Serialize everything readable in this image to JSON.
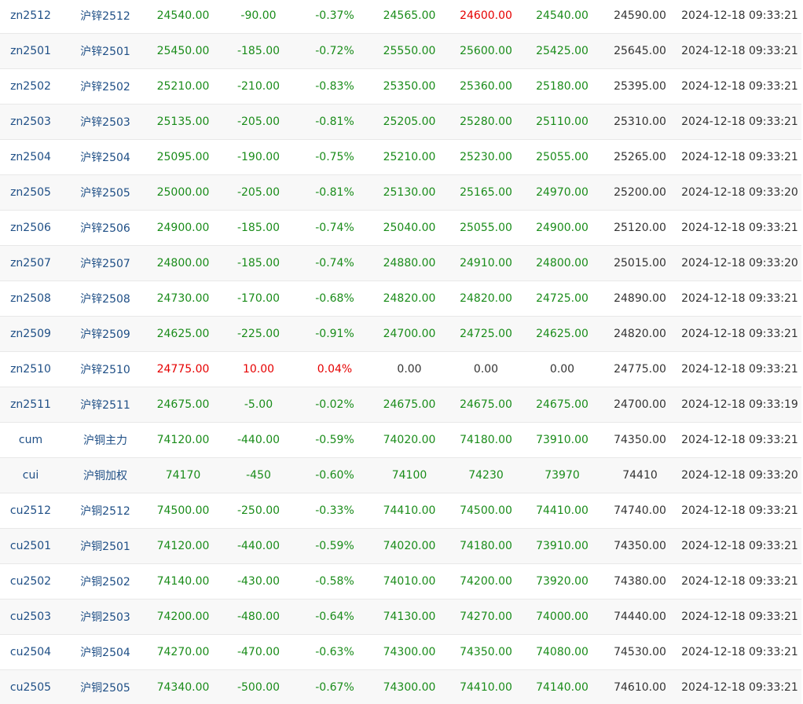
{
  "colors": {
    "up": "#e60000",
    "down": "#1a8c1a",
    "flat": "#333333",
    "link": "#1f4f86"
  },
  "rows": [
    {
      "code": "zn2512",
      "name": "沪锌2512",
      "last": "24540.00",
      "change": "-90.00",
      "pct": "-0.37%",
      "open": "24565.00",
      "high": "24600.00",
      "low": "24540.00",
      "prev": "24590.00",
      "time": "2024-12-18 09:33:21",
      "trend": "down",
      "open_c": "down",
      "high_c": "up",
      "low_c": "down"
    },
    {
      "code": "zn2501",
      "name": "沪锌2501",
      "last": "25450.00",
      "change": "-185.00",
      "pct": "-0.72%",
      "open": "25550.00",
      "high": "25600.00",
      "low": "25425.00",
      "prev": "25645.00",
      "time": "2024-12-18 09:33:21",
      "trend": "down",
      "open_c": "down",
      "high_c": "down",
      "low_c": "down"
    },
    {
      "code": "zn2502",
      "name": "沪锌2502",
      "last": "25210.00",
      "change": "-210.00",
      "pct": "-0.83%",
      "open": "25350.00",
      "high": "25360.00",
      "low": "25180.00",
      "prev": "25395.00",
      "time": "2024-12-18 09:33:21",
      "trend": "down",
      "open_c": "down",
      "high_c": "down",
      "low_c": "down"
    },
    {
      "code": "zn2503",
      "name": "沪锌2503",
      "last": "25135.00",
      "change": "-205.00",
      "pct": "-0.81%",
      "open": "25205.00",
      "high": "25280.00",
      "low": "25110.00",
      "prev": "25310.00",
      "time": "2024-12-18 09:33:21",
      "trend": "down",
      "open_c": "down",
      "high_c": "down",
      "low_c": "down"
    },
    {
      "code": "zn2504",
      "name": "沪锌2504",
      "last": "25095.00",
      "change": "-190.00",
      "pct": "-0.75%",
      "open": "25210.00",
      "high": "25230.00",
      "low": "25055.00",
      "prev": "25265.00",
      "time": "2024-12-18 09:33:21",
      "trend": "down",
      "open_c": "down",
      "high_c": "down",
      "low_c": "down"
    },
    {
      "code": "zn2505",
      "name": "沪锌2505",
      "last": "25000.00",
      "change": "-205.00",
      "pct": "-0.81%",
      "open": "25130.00",
      "high": "25165.00",
      "low": "24970.00",
      "prev": "25200.00",
      "time": "2024-12-18 09:33:20",
      "trend": "down",
      "open_c": "down",
      "high_c": "down",
      "low_c": "down"
    },
    {
      "code": "zn2506",
      "name": "沪锌2506",
      "last": "24900.00",
      "change": "-185.00",
      "pct": "-0.74%",
      "open": "25040.00",
      "high": "25055.00",
      "low": "24900.00",
      "prev": "25120.00",
      "time": "2024-12-18 09:33:21",
      "trend": "down",
      "open_c": "down",
      "high_c": "down",
      "low_c": "down"
    },
    {
      "code": "zn2507",
      "name": "沪锌2507",
      "last": "24800.00",
      "change": "-185.00",
      "pct": "-0.74%",
      "open": "24880.00",
      "high": "24910.00",
      "low": "24800.00",
      "prev": "25015.00",
      "time": "2024-12-18 09:33:20",
      "trend": "down",
      "open_c": "down",
      "high_c": "down",
      "low_c": "down"
    },
    {
      "code": "zn2508",
      "name": "沪锌2508",
      "last": "24730.00",
      "change": "-170.00",
      "pct": "-0.68%",
      "open": "24820.00",
      "high": "24820.00",
      "low": "24725.00",
      "prev": "24890.00",
      "time": "2024-12-18 09:33:21",
      "trend": "down",
      "open_c": "down",
      "high_c": "down",
      "low_c": "down"
    },
    {
      "code": "zn2509",
      "name": "沪锌2509",
      "last": "24625.00",
      "change": "-225.00",
      "pct": "-0.91%",
      "open": "24700.00",
      "high": "24725.00",
      "low": "24625.00",
      "prev": "24820.00",
      "time": "2024-12-18 09:33:21",
      "trend": "down",
      "open_c": "down",
      "high_c": "down",
      "low_c": "down"
    },
    {
      "code": "zn2510",
      "name": "沪锌2510",
      "last": "24775.00",
      "change": "10.00",
      "pct": "0.04%",
      "open": "0.00",
      "high": "0.00",
      "low": "0.00",
      "prev": "24775.00",
      "time": "2024-12-18 09:33:21",
      "trend": "up",
      "open_c": "flat",
      "high_c": "flat",
      "low_c": "flat"
    },
    {
      "code": "zn2511",
      "name": "沪锌2511",
      "last": "24675.00",
      "change": "-5.00",
      "pct": "-0.02%",
      "open": "24675.00",
      "high": "24675.00",
      "low": "24675.00",
      "prev": "24700.00",
      "time": "2024-12-18 09:33:19",
      "trend": "down",
      "open_c": "down",
      "high_c": "down",
      "low_c": "down"
    },
    {
      "code": "cum",
      "name": "沪铜主力",
      "last": "74120.00",
      "change": "-440.00",
      "pct": "-0.59%",
      "open": "74020.00",
      "high": "74180.00",
      "low": "73910.00",
      "prev": "74350.00",
      "time": "2024-12-18 09:33:21",
      "trend": "down",
      "open_c": "down",
      "high_c": "down",
      "low_c": "down"
    },
    {
      "code": "cui",
      "name": "沪铜加权",
      "last": "74170",
      "change": "-450",
      "pct": "-0.60%",
      "open": "74100",
      "high": "74230",
      "low": "73970",
      "prev": "74410",
      "time": "2024-12-18 09:33:20",
      "trend": "down",
      "open_c": "down",
      "high_c": "down",
      "low_c": "down"
    },
    {
      "code": "cu2512",
      "name": "沪铜2512",
      "last": "74500.00",
      "change": "-250.00",
      "pct": "-0.33%",
      "open": "74410.00",
      "high": "74500.00",
      "low": "74410.00",
      "prev": "74740.00",
      "time": "2024-12-18 09:33:21",
      "trend": "down",
      "open_c": "down",
      "high_c": "down",
      "low_c": "down"
    },
    {
      "code": "cu2501",
      "name": "沪铜2501",
      "last": "74120.00",
      "change": "-440.00",
      "pct": "-0.59%",
      "open": "74020.00",
      "high": "74180.00",
      "low": "73910.00",
      "prev": "74350.00",
      "time": "2024-12-18 09:33:21",
      "trend": "down",
      "open_c": "down",
      "high_c": "down",
      "low_c": "down"
    },
    {
      "code": "cu2502",
      "name": "沪铜2502",
      "last": "74140.00",
      "change": "-430.00",
      "pct": "-0.58%",
      "open": "74010.00",
      "high": "74200.00",
      "low": "73920.00",
      "prev": "74380.00",
      "time": "2024-12-18 09:33:21",
      "trend": "down",
      "open_c": "down",
      "high_c": "down",
      "low_c": "down"
    },
    {
      "code": "cu2503",
      "name": "沪铜2503",
      "last": "74200.00",
      "change": "-480.00",
      "pct": "-0.64%",
      "open": "74130.00",
      "high": "74270.00",
      "low": "74000.00",
      "prev": "74440.00",
      "time": "2024-12-18 09:33:21",
      "trend": "down",
      "open_c": "down",
      "high_c": "down",
      "low_c": "down"
    },
    {
      "code": "cu2504",
      "name": "沪铜2504",
      "last": "74270.00",
      "change": "-470.00",
      "pct": "-0.63%",
      "open": "74300.00",
      "high": "74350.00",
      "low": "74080.00",
      "prev": "74530.00",
      "time": "2024-12-18 09:33:21",
      "trend": "down",
      "open_c": "down",
      "high_c": "down",
      "low_c": "down"
    },
    {
      "code": "cu2505",
      "name": "沪铜2505",
      "last": "74340.00",
      "change": "-500.00",
      "pct": "-0.67%",
      "open": "74300.00",
      "high": "74410.00",
      "low": "74140.00",
      "prev": "74610.00",
      "time": "2024-12-18 09:33:21",
      "trend": "down",
      "open_c": "down",
      "high_c": "down",
      "low_c": "down"
    }
  ]
}
